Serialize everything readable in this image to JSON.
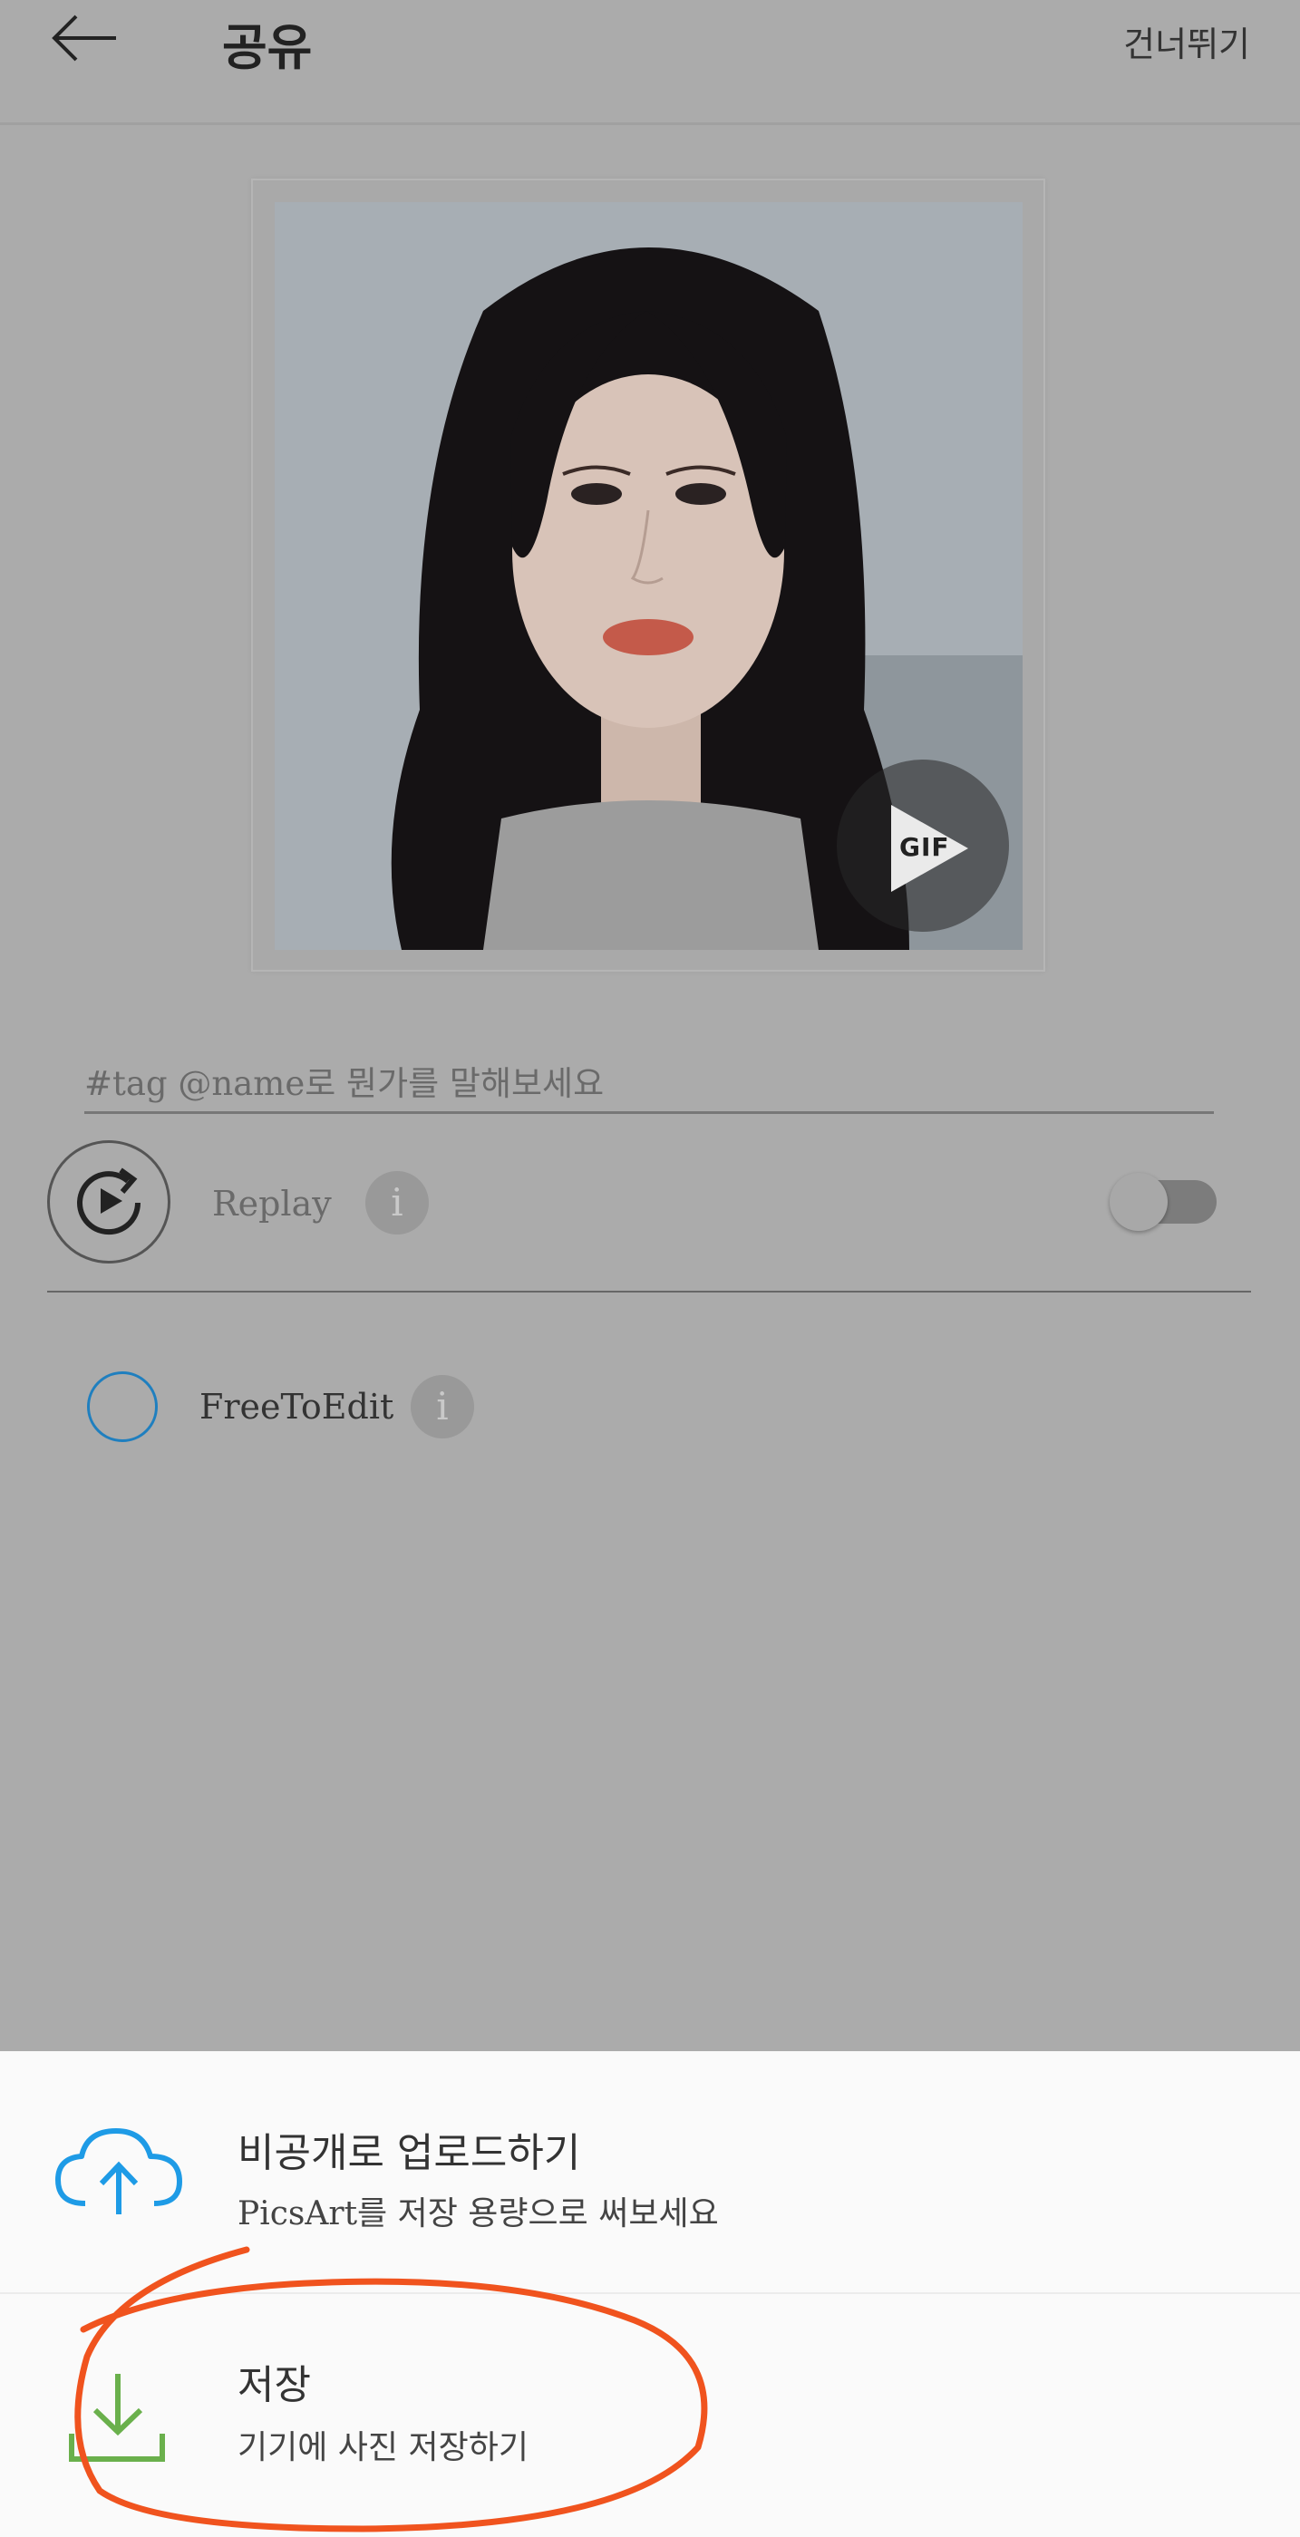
{
  "header": {
    "title": "공유",
    "skip_label": "건너뛰기",
    "back_icon": "arrow-left-icon"
  },
  "preview": {
    "gif_badge": "GIF"
  },
  "caption": {
    "placeholder": "#tag @name로 뭔가를 말해보세요"
  },
  "replay": {
    "label": "Replay",
    "info_icon_glyph": "i",
    "toggle_on": false
  },
  "free_to_edit": {
    "label": "FreeToEdit",
    "info_icon_glyph": "i",
    "checked": false
  },
  "bottom_sheet": {
    "upload": {
      "title": "비공개로 업로드하기",
      "subtitle": "PicsArt를 저장 용량으로 써보세요",
      "icon": "cloud-upload-icon",
      "icon_color": "#1e9be6"
    },
    "save": {
      "title": "저장",
      "subtitle": "기기에 사진 저장하기",
      "icon": "download-icon",
      "icon_color": "#6ab04c"
    }
  },
  "colors": {
    "overlay": "#ababab",
    "annotation": "#f0531e"
  }
}
